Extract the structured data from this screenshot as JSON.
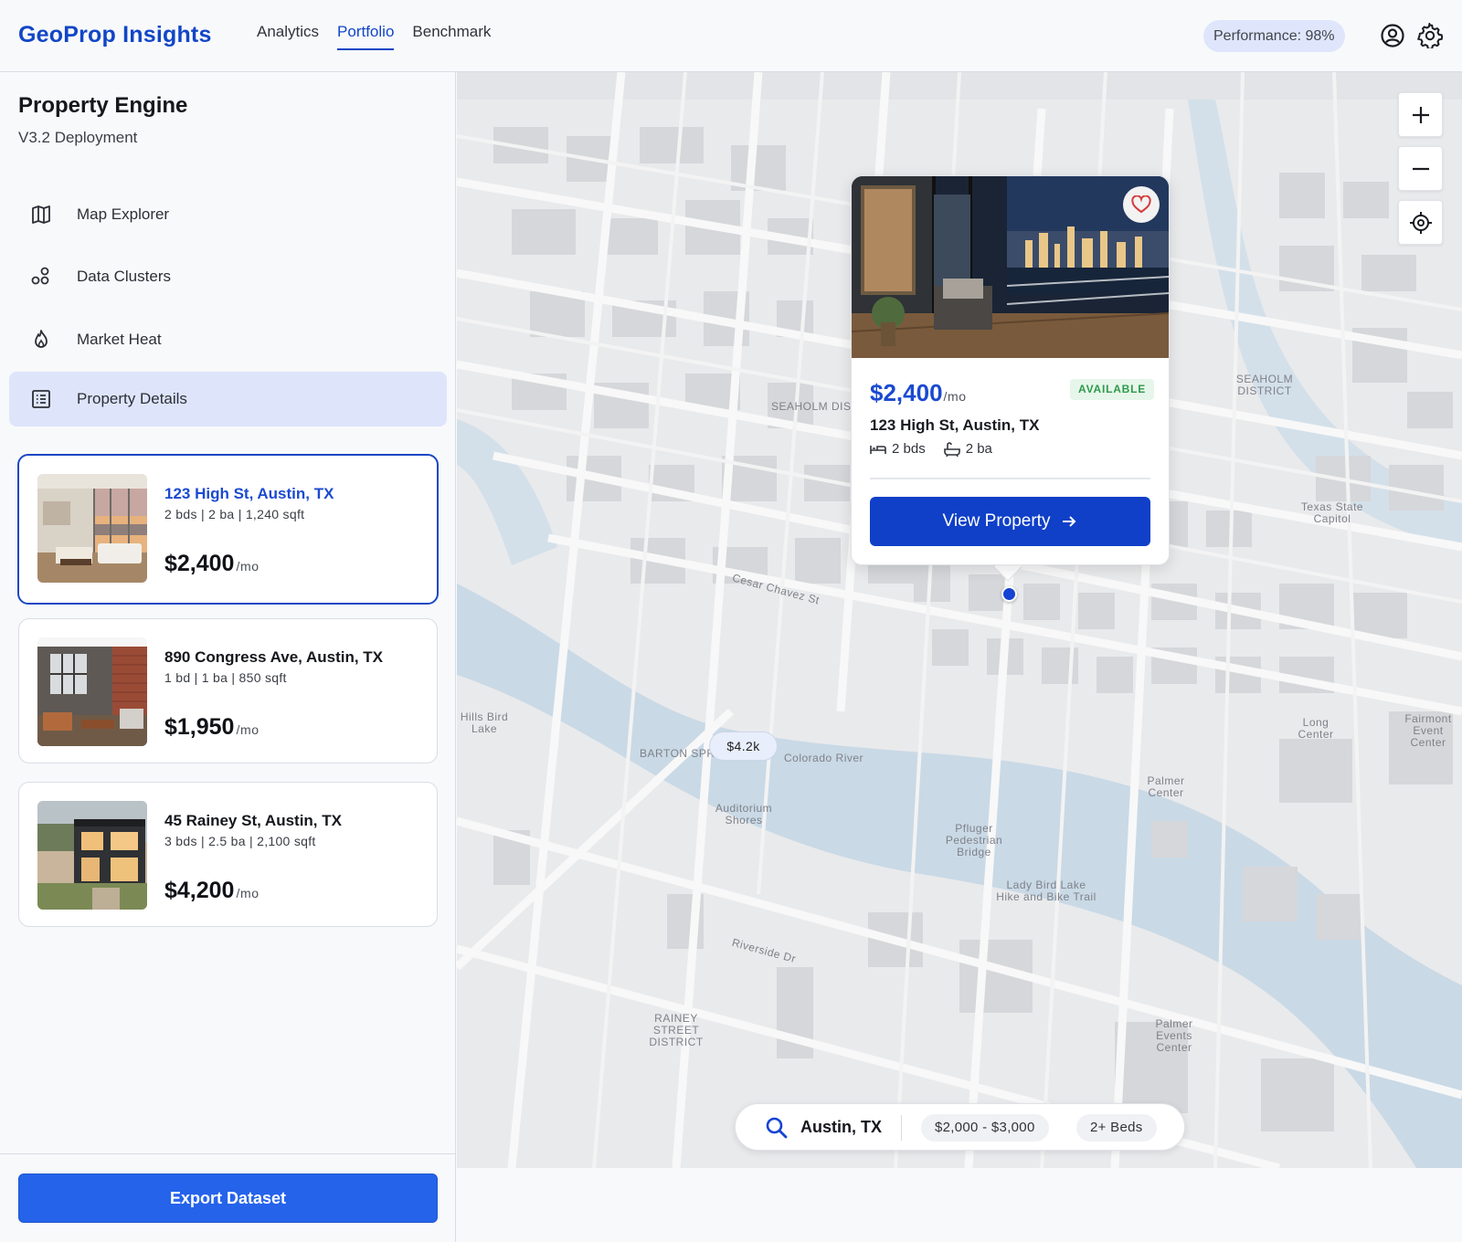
{
  "header": {
    "brand": "GeoProp Insights",
    "nav": [
      "Analytics",
      "Portfolio",
      "Benchmark"
    ],
    "active_nav": "Portfolio",
    "performance": "Performance: 98%"
  },
  "sidebar": {
    "title": "Property Engine",
    "subtitle": "V3.2 Deployment",
    "menu": [
      {
        "label": "Map Explorer",
        "icon": "map-icon"
      },
      {
        "label": "Data Clusters",
        "icon": "clusters-icon"
      },
      {
        "label": "Market Heat",
        "icon": "flame-icon"
      },
      {
        "label": "Property Details",
        "icon": "list-details-icon",
        "active": true
      }
    ],
    "listings": [
      {
        "address": "123 High St, Austin, TX",
        "specs": "2 bds | 2 ba | 1,240 sqft",
        "price": "$2,400",
        "unit": "/mo",
        "selected": true
      },
      {
        "address": "890 Congress Ave, Austin, TX",
        "specs": "1 bd | 1 ba | 850 sqft",
        "price": "$1,950",
        "unit": "/mo"
      },
      {
        "address": "45 Rainey St, Austin, TX",
        "specs": "3 bds | 2.5 ba | 2,100 sqft",
        "price": "$4,200",
        "unit": "/mo"
      }
    ],
    "export_label": "Export Dataset"
  },
  "map": {
    "cluster_label": "$4.2k",
    "labels": {
      "district_w": "SEAHOLM DISTRICT",
      "district_e": "SEAHOLM DISTRICT",
      "cesar": "Cesar Chavez St",
      "colorado": "Colorado River",
      "auditorium": "Auditorium Shores",
      "pfluger": "Pfluger Pedestrian Bridge",
      "lady_bird": "Lady Bird Lake Hike and Bike Trail",
      "barton": "BARTON SPRINGS RD",
      "riverside": "Riverside Dr",
      "rainey": "RAINEY STREET DISTRICT",
      "palmer_center": "Palmer Center",
      "palmer_events": "Palmer Events Center",
      "long_center": "Long Center",
      "hills": "Hills Bird Lake",
      "texas_capitol": "Texas State Capitol",
      "fairmont": "Fairmont Event Center"
    },
    "colors": {
      "water": "#c9d9e6",
      "land": "#e9eaec",
      "block": "#d6d7da",
      "road": "#f8f8f8",
      "accent": "#1543d2"
    }
  },
  "popup": {
    "price": "$2,400",
    "unit": "/mo",
    "status": "AVAILABLE",
    "address": "123 High St, Austin, TX",
    "beds": "2 bds",
    "baths": "2 ba",
    "button": "View Property"
  },
  "search": {
    "location": "Austin, TX",
    "price_range": "$2,000 - $3,000",
    "beds": "2+ Beds"
  }
}
